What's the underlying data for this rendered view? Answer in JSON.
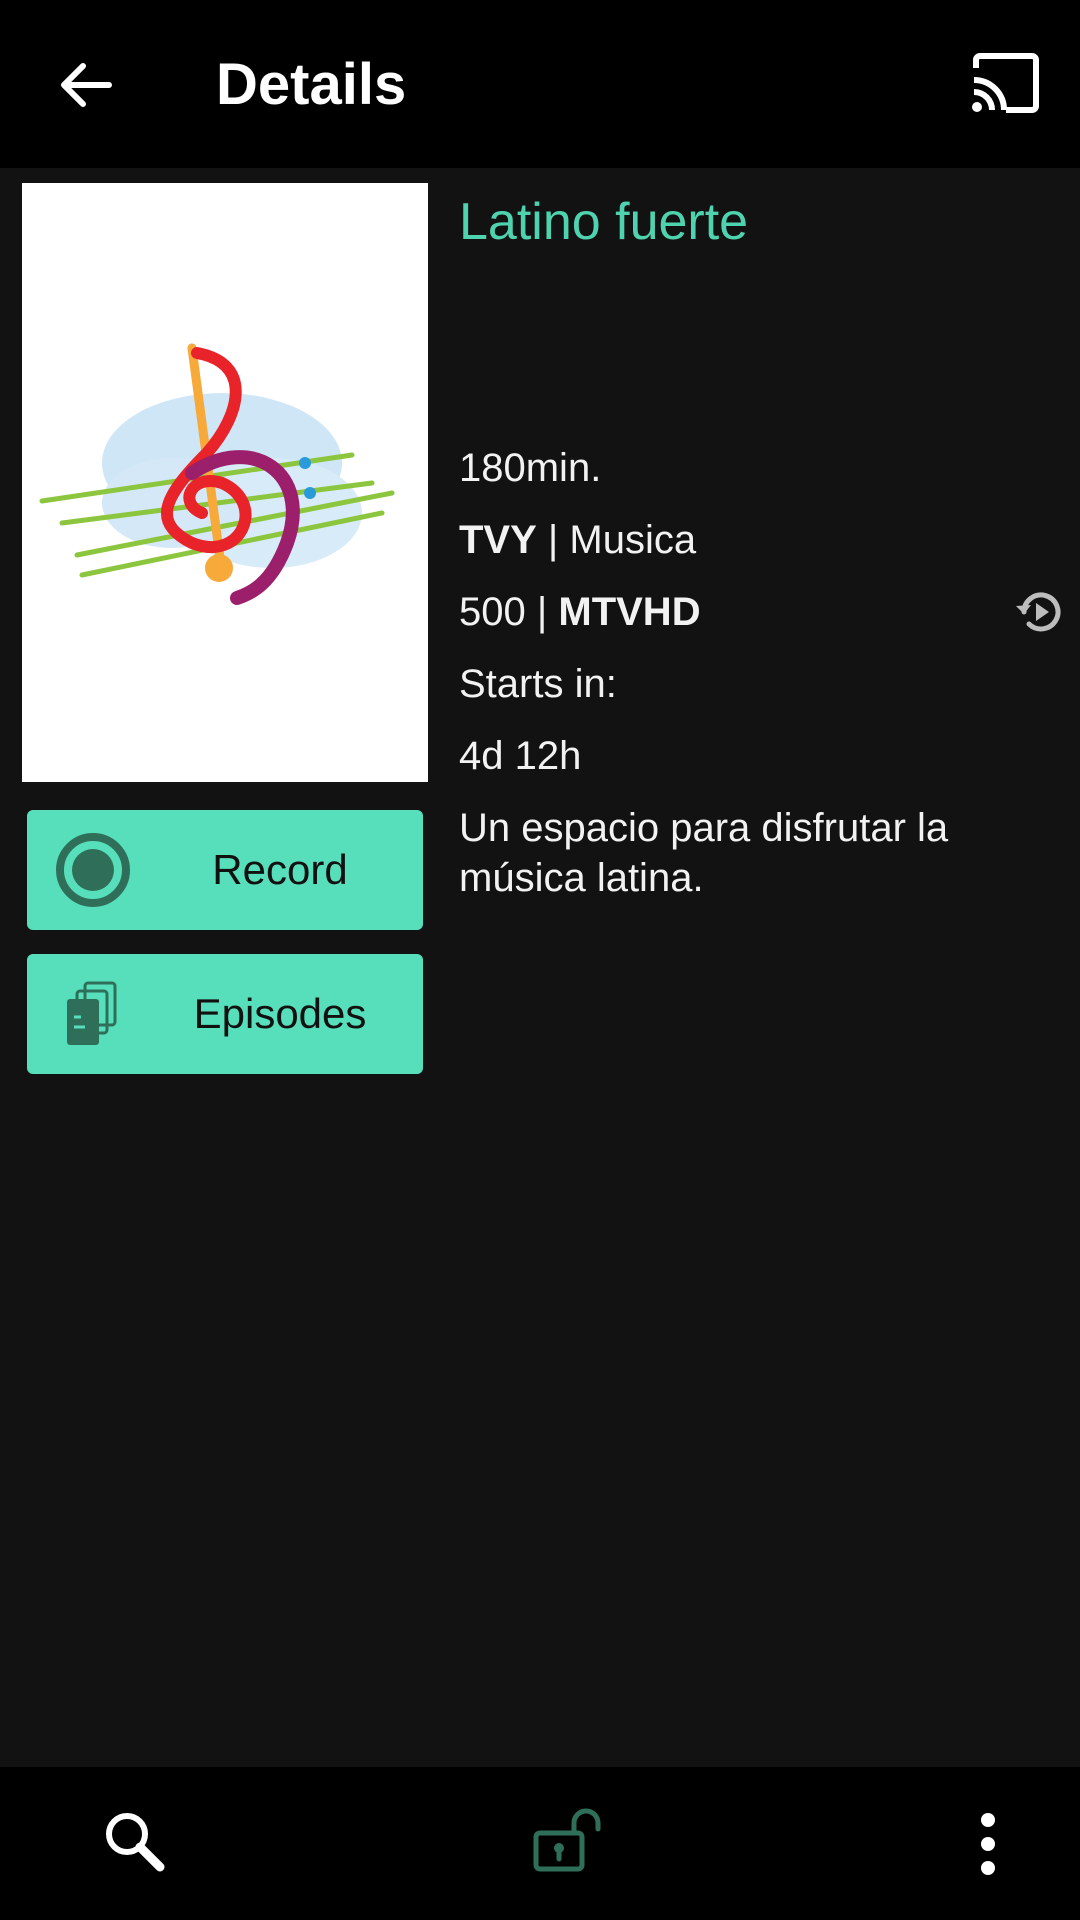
{
  "header": {
    "title": "Details",
    "back_icon": "arrow-back-icon",
    "cast_icon": "cast-icon"
  },
  "program": {
    "title": "Latino fuerte",
    "duration": "180min.",
    "rating": "TVY",
    "separator": " | ",
    "genre": "Musica",
    "channel_number": "500",
    "channel_name": "MTVHD",
    "starts_label": "Starts in:",
    "starts_value": "4d 12h",
    "description": "Un espacio para disfrutar la música latina."
  },
  "actions": {
    "record_label": "Record",
    "episodes_label": "Episodes"
  },
  "bottom_nav": {
    "search_icon": "search-icon",
    "lock_icon": "lock-open-icon",
    "more_icon": "more-vert-icon"
  },
  "colors": {
    "accent": "#57dfbb",
    "title_accent": "#4fd3ae",
    "background": "#121212",
    "bar": "#000000"
  }
}
